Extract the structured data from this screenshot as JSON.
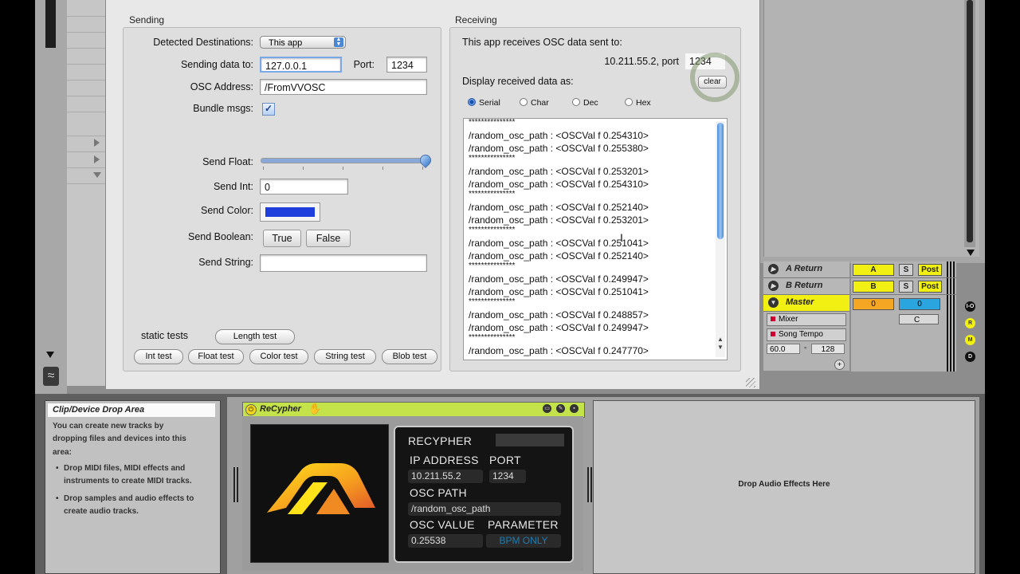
{
  "sending": {
    "title": "Sending",
    "detected_label": "Detected Destinations:",
    "detected_value": "This app",
    "sending_label": "Sending data to:",
    "sending_value": "127.0.0.1",
    "port_label": "Port:",
    "port_value": "1234",
    "osc_address_label": "OSC Address:",
    "osc_address_value": "/FromVVOSC",
    "bundle_label": "Bundle msgs:",
    "bundle_checked": true,
    "send_float_label": "Send Float:",
    "send_float_value": 1.0,
    "send_int_label": "Send Int:",
    "send_int_value": "0",
    "send_color_label": "Send Color:",
    "send_color_value": "#1f3fdc",
    "send_boolean_label": "Send Boolean:",
    "true_label": "True",
    "false_label": "False",
    "send_string_label": "Send String:",
    "send_string_value": "",
    "static_tests_label": "static tests",
    "length_test": "Length test",
    "tests": [
      "Int test",
      "Float test",
      "Color test",
      "String test",
      "Blob test"
    ]
  },
  "receiving": {
    "title": "Receiving",
    "receives_text": "This app receives OSC data sent to:",
    "address_text": "10.211.55.2, port",
    "port_value": "1234",
    "clear_label": "clear",
    "display_label": "Display received data as:",
    "modes": [
      "Serial",
      "Char",
      "Dec",
      "Hex"
    ],
    "selected_mode": "Serial",
    "log": [
      "***************",
      "/random_osc_path : <OSCVal f 0.254310>",
      "/random_osc_path : <OSCVal f 0.255380>",
      "***************",
      "/random_osc_path : <OSCVal f 0.253201>",
      "/random_osc_path : <OSCVal f 0.254310>",
      "***************",
      "/random_osc_path : <OSCVal f 0.252140>",
      "/random_osc_path : <OSCVal f 0.253201>",
      "***************",
      "/random_osc_path : <OSCVal f 0.251041>",
      "/random_osc_path : <OSCVal f 0.252140>",
      "***************",
      "/random_osc_path : <OSCVal f 0.249947>",
      "/random_osc_path : <OSCVal f 0.251041>",
      "***************",
      "/random_osc_path : <OSCVal f 0.248857>",
      "/random_osc_path : <OSCVal f 0.249947>",
      "***************",
      "/random_osc_path : <OSCVal f 0.247770>"
    ]
  },
  "mixer": {
    "a_return": "A Return",
    "b_return": "B Return",
    "master": "Master",
    "a_btn": "A",
    "b_btn": "B",
    "master_val_left": "0",
    "master_val_right": "0",
    "s_label": "S",
    "post_label": "Post",
    "c_label": "C",
    "mixer_select": "Mixer",
    "song_tempo_select": "Song Tempo",
    "tempo_min": "60.0",
    "tempo_dash": "-",
    "tempo_max": "128",
    "io_labels": [
      "I-O",
      "R",
      "M",
      "D"
    ]
  },
  "info": {
    "title": "Clip/Device Drop Area",
    "line1": "You can create new tracks by",
    "line2": "dropping files and devices into this",
    "line3": "area:",
    "bullet1a": "Drop MIDI files, MIDI effects and",
    "bullet1b": "instruments to create MIDI tracks.",
    "bullet2a": "Drop samples and audio effects to",
    "bullet2b": "create audio tracks."
  },
  "device": {
    "name": "ReCypher",
    "drop_text": "Drop Audio Effects Here",
    "panel_title": "RECYPHER",
    "ip_label": "IP ADDRESS",
    "port_label": "PORT",
    "ip_value": "10.211.55.2",
    "port_value": "1234",
    "osc_path_label": "OSC PATH",
    "osc_path_value": "/random_osc_path",
    "osc_value_label": "OSC VALUE",
    "parameter_label": "PARAMETER",
    "osc_value": "0.25538",
    "parameter_value": "BPM ONLY",
    "accent_color": "#c4e24a"
  }
}
